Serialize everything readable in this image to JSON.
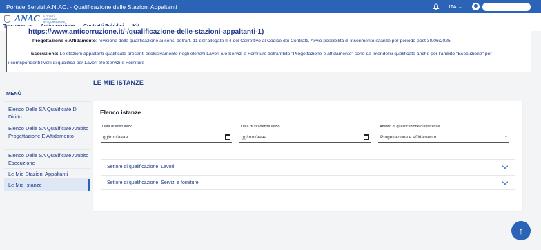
{
  "topbar": {
    "title": "Portale Servizi A.N.AC. - Qualificazione delle Stazioni Appaltanti",
    "language": "ITA",
    "language_chevron": "⌄"
  },
  "header": {
    "brand": "ANAC",
    "brand_sub_1": "AUTORITÀ",
    "brand_sub_2": "NAZIONALE",
    "brand_sub_3": "ANTICORRUZIONE",
    "nav": [
      {
        "label": "Trasparenza"
      },
      {
        "label": "Anticorruzione"
      },
      {
        "label": "Contratti Pubblici"
      },
      {
        "label": "Kit"
      }
    ],
    "nav_chevron": "⌄"
  },
  "banner": {
    "url": "https://www.anticorruzione.it/-/qualificazione-delle-stazioni-appaltanti-1)",
    "p1_bold": "Progettazione e Affidamento",
    "p1_text": ": revisione della qualificazione ai sensi dell'art. 11 dell'allegato II.4 del Correttivo al Codice dei Contratti. Avvio possibilità di inserimento istanze per periodo post 30/06/2025",
    "p2_bold": "Esecuzione:",
    "p2_text": " Le stazioni appaltanti qualificate presenti esclusivamente negli elenchi Lavori e/o Servizi e Forniture dell'ambito \"Progettazione e affidamento\" sono da intendersi qualificate anche per l'ambito \"Esecuzione\" per",
    "p3_text": "i corrispondenti livelli di qualifica per Lavori e/o Servizi e Forniture"
  },
  "sidebar": {
    "title": "MENÙ",
    "items": [
      {
        "label": "Elenco Delle SA Qualificate Di Diritto"
      },
      {
        "label": "Elenco Delle SA Qualificate Ambito Progettazione E Affidamento"
      },
      {
        "label": "Elenco Delle SA Qualificate Ambito Esecuzione"
      },
      {
        "label": "Le Mie Stazioni Appaltanti"
      },
      {
        "label": "Le Mie Istanze"
      }
    ]
  },
  "main": {
    "title": "LE MIE ISTANZE",
    "card_title": "Elenco istanze",
    "filters": {
      "invio_label": "Data di invio inizio",
      "invio_value": "gg/mm/aaaa",
      "scadenza_label": "Data di scadenza inizio",
      "scadenza_value": "gg/mm/aaaa",
      "ambito_label": "Ambito di qualificazione di interesse",
      "ambito_value": "Progettazione e affidamento"
    },
    "accordions": [
      {
        "label": "Settore di qualificazione: Lavori"
      },
      {
        "label": "Settore di qualificazione: Servizi e forniture"
      }
    ]
  },
  "fab": {
    "glyph": "↑"
  }
}
